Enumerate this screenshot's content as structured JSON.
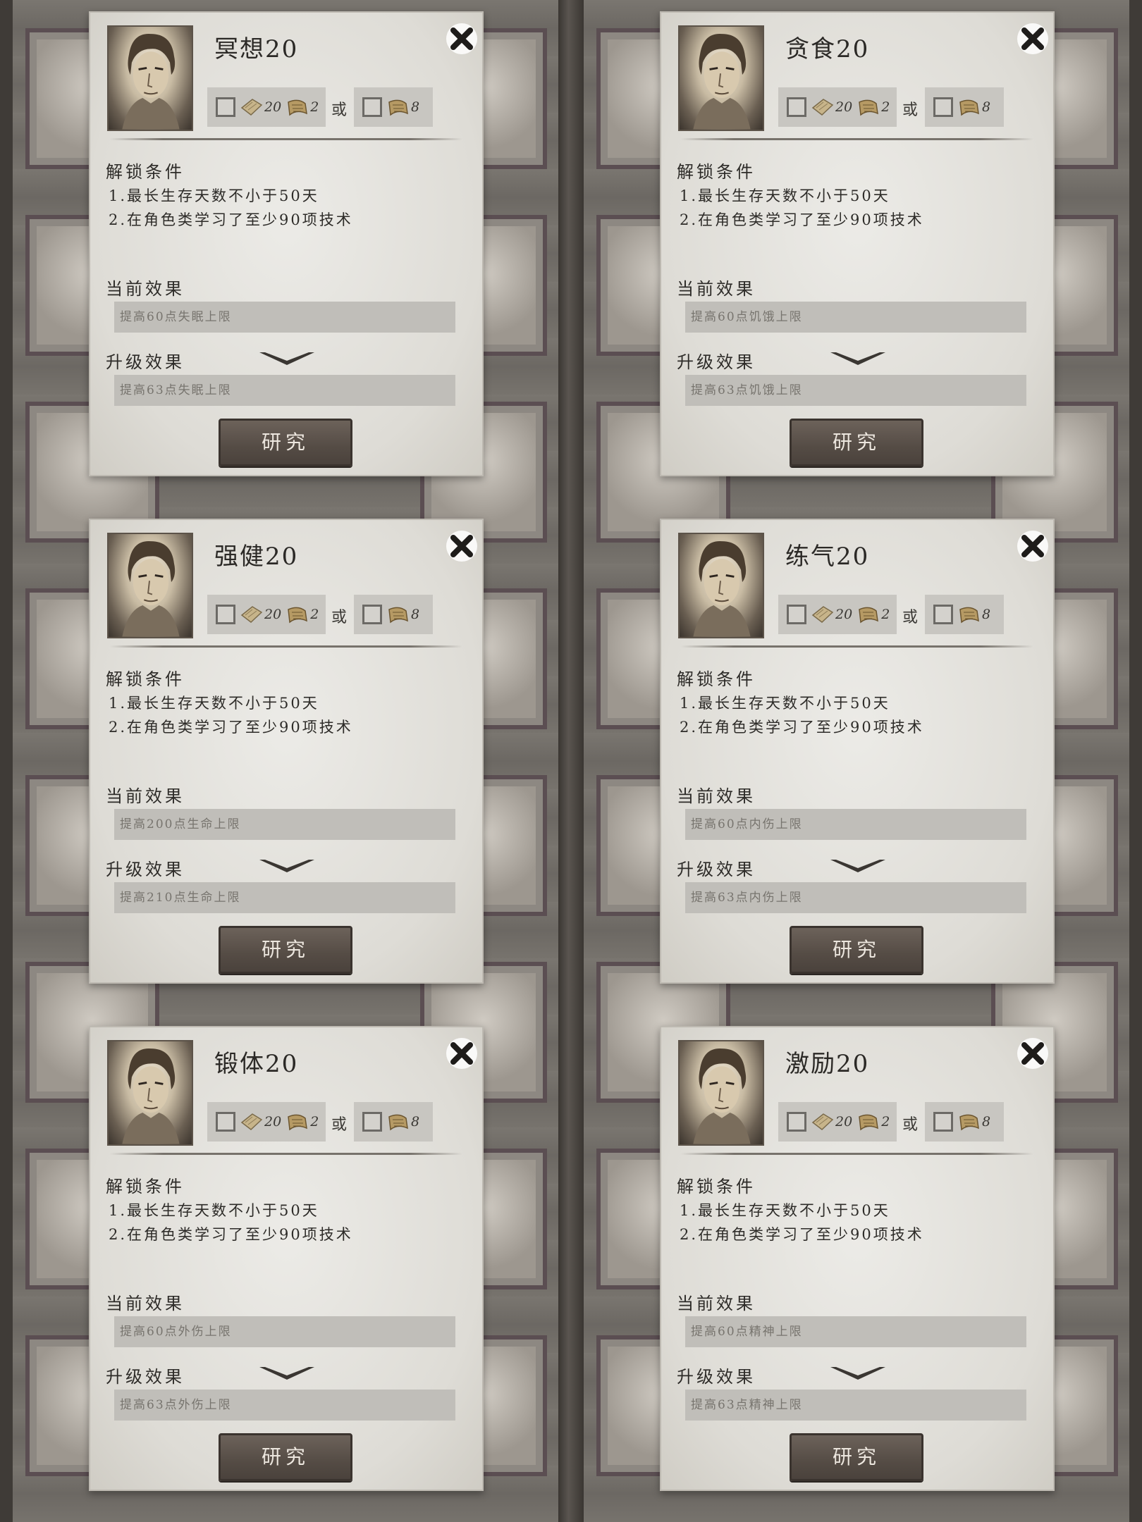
{
  "dialogs": [
    {
      "title": "冥想20",
      "cost_a_1": "20",
      "cost_a_2": "2",
      "or": "或",
      "cost_b": "8",
      "unlock_label": "解锁条件",
      "cond1": "1.最长生存天数不小于50天",
      "cond2": "2.在角色类学习了至少90项技术",
      "current_label": "当前效果",
      "current_effect": "提高60点失眠上限",
      "upgrade_label": "升级效果",
      "upgrade_effect": "提高63点失眠上限",
      "button": "研究"
    },
    {
      "title": "贪食20",
      "cost_a_1": "20",
      "cost_a_2": "2",
      "or": "或",
      "cost_b": "8",
      "unlock_label": "解锁条件",
      "cond1": "1.最长生存天数不小于50天",
      "cond2": "2.在角色类学习了至少90项技术",
      "current_label": "当前效果",
      "current_effect": "提高60点饥饿上限",
      "upgrade_label": "升级效果",
      "upgrade_effect": "提高63点饥饿上限",
      "button": "研究"
    },
    {
      "title": "强健20",
      "cost_a_1": "20",
      "cost_a_2": "2",
      "or": "或",
      "cost_b": "8",
      "unlock_label": "解锁条件",
      "cond1": "1.最长生存天数不小于50天",
      "cond2": "2.在角色类学习了至少90项技术",
      "current_label": "当前效果",
      "current_effect": "提高200点生命上限",
      "upgrade_label": "升级效果",
      "upgrade_effect": "提高210点生命上限",
      "button": "研究"
    },
    {
      "title": "练气20",
      "cost_a_1": "20",
      "cost_a_2": "2",
      "or": "或",
      "cost_b": "8",
      "unlock_label": "解锁条件",
      "cond1": "1.最长生存天数不小于50天",
      "cond2": "2.在角色类学习了至少90项技术",
      "current_label": "当前效果",
      "current_effect": "提高60点内伤上限",
      "upgrade_label": "升级效果",
      "upgrade_effect": "提高63点内伤上限",
      "button": "研究"
    },
    {
      "title": "锻体20",
      "cost_a_1": "20",
      "cost_a_2": "2",
      "or": "或",
      "cost_b": "8",
      "unlock_label": "解锁条件",
      "cond1": "1.最长生存天数不小于50天",
      "cond2": "2.在角色类学习了至少90项技术",
      "current_label": "当前效果",
      "current_effect": "提高60点外伤上限",
      "upgrade_label": "升级效果",
      "upgrade_effect": "提高63点外伤上限",
      "button": "研究"
    },
    {
      "title": "激励20",
      "cost_a_1": "20",
      "cost_a_2": "2",
      "or": "或",
      "cost_b": "8",
      "unlock_label": "解锁条件",
      "cond1": "1.最长生存天数不小于50天",
      "cond2": "2.在角色类学习了至少90项技术",
      "current_label": "当前效果",
      "current_effect": "提高60点精神上限",
      "upgrade_label": "升级效果",
      "upgrade_effect": "提高63点精神上限",
      "button": "研究"
    }
  ],
  "icons": {
    "close": "close-icon",
    "material_plank": "wood-plank-icon",
    "material_scroll": "scroll-icon",
    "expand": "chevron-down-icon",
    "portrait": "character-portrait"
  },
  "colors": {
    "panel": "#e3e1dc",
    "button": "#5a514a",
    "button_text": "#ece6de",
    "effect_box": "#c0beb9",
    "cost_box": "#c8c6c1"
  }
}
